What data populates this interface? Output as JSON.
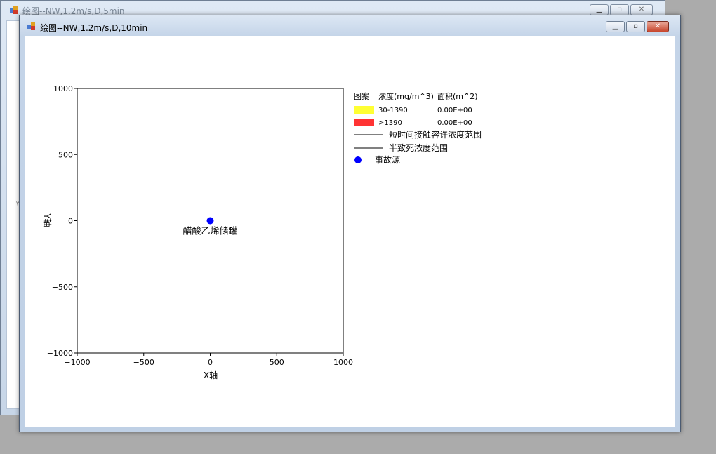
{
  "back_window": {
    "title": "绘图--NW,1.2m/s,D,5min",
    "side_glyph": "ᵧ",
    "buttons": {
      "minimize": "▁",
      "maximize": "▫",
      "close": "✕"
    }
  },
  "front_window": {
    "title": "绘图--NW,1.2m/s,D,10min",
    "buttons": {
      "minimize": "▁",
      "maximize": "▫",
      "close": "✕"
    }
  },
  "chart_data": {
    "type": "scatter",
    "title": "",
    "xlabel": "X轴",
    "ylabel": "Y轴",
    "xlim": [
      -1000,
      1000
    ],
    "ylim": [
      -1000,
      1000
    ],
    "xticks": [
      -1000,
      -500,
      0,
      500,
      1000
    ],
    "yticks": [
      1000,
      500,
      0,
      -500,
      -1000
    ],
    "xtick_labels": [
      "−1000",
      "−500",
      "0",
      "500",
      "1000"
    ],
    "ytick_labels": [
      "1000",
      "500",
      "0",
      "−500",
      "−1000"
    ],
    "points": [
      {
        "x": 0,
        "y": 0,
        "label": "醋酸乙烯储罐",
        "color": "#0000ff"
      }
    ],
    "grid": false,
    "legend": {
      "placement": "right",
      "header": {
        "pattern": "图案",
        "concentration": "浓度(mg/m^3)",
        "area": "面积(m^2)"
      },
      "rows": [
        {
          "color": "#ffff33",
          "range": "30-1390",
          "area": "0.00E+00"
        },
        {
          "color": "#ff3333",
          "range": ">1390",
          "area": "0.00E+00"
        }
      ],
      "lines": [
        {
          "label": "短时间接触容许浓度范围"
        },
        {
          "label": "半致死浓度范围"
        }
      ],
      "marker": {
        "label": "事故源",
        "color": "#0000ff"
      }
    }
  }
}
